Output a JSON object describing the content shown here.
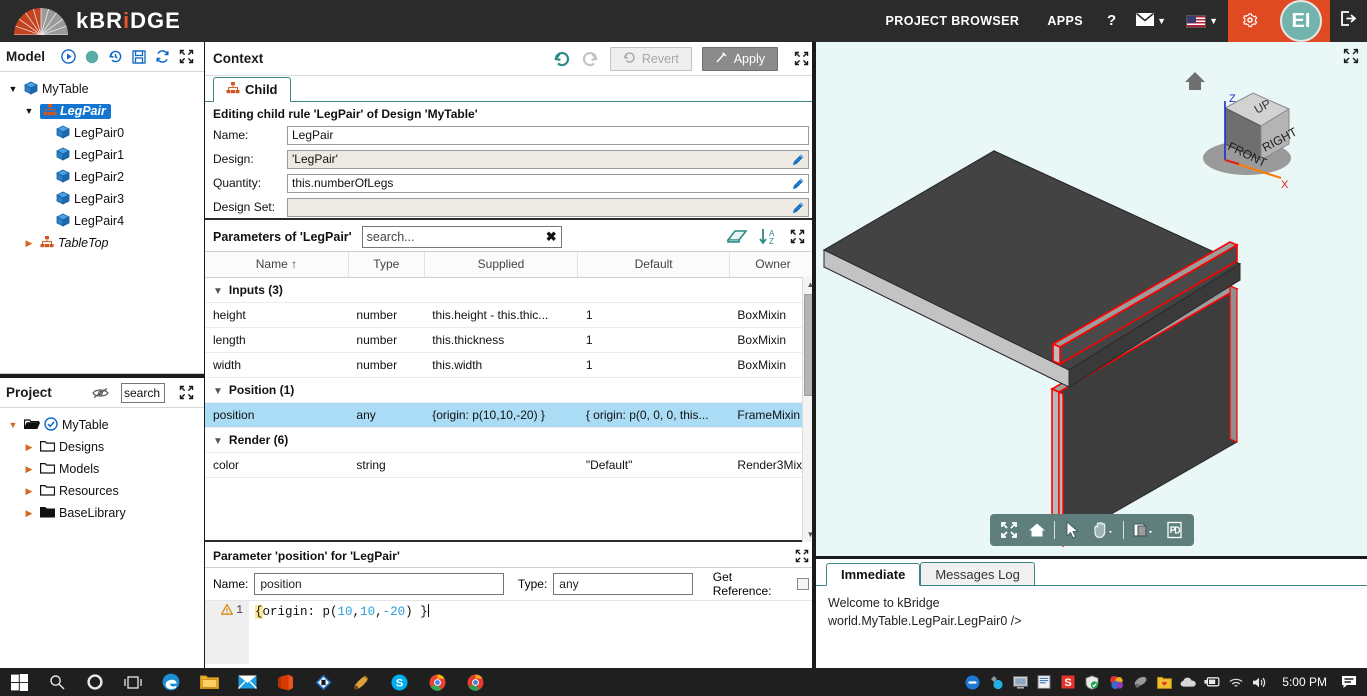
{
  "header": {
    "logo_text_1": "kBR",
    "logo_text_i": "i",
    "logo_text_2": "DGE",
    "project_browser": "PROJECT BROWSER",
    "apps": "APPS",
    "help": "?",
    "mail_icon": "mail-icon",
    "flag_icon": "us-flag-icon",
    "gear_icon": "gear-icon",
    "avatar_initials": "EI",
    "logout_icon": "logout-icon",
    "accent_orange": "#e04a22",
    "avatar_color": "#73b3ad"
  },
  "model_panel": {
    "title": "Model",
    "toolbar": [
      {
        "name": "run-icon",
        "glyph": "▶"
      },
      {
        "name": "status-dot-icon",
        "glyph": "●"
      },
      {
        "name": "history-icon",
        "glyph": "↺"
      },
      {
        "name": "save-icon",
        "glyph": "὚B"
      },
      {
        "name": "refresh-icon",
        "glyph": "↻"
      },
      {
        "name": "expand-icon",
        "glyph": "⤡"
      }
    ],
    "tree": [
      {
        "label": "MyTable",
        "icon": "cube-icon",
        "indent": 0,
        "twisty": "down",
        "selected": false,
        "italic": false
      },
      {
        "label": "LegPair",
        "icon": "tree-icon",
        "indent": 1,
        "twisty": "down",
        "selected": true,
        "italic": true
      },
      {
        "label": "LegPair0",
        "icon": "cube-icon",
        "indent": 2,
        "twisty": "none",
        "selected": false,
        "italic": false
      },
      {
        "label": "LegPair1",
        "icon": "cube-icon",
        "indent": 2,
        "twisty": "none",
        "selected": false,
        "italic": false
      },
      {
        "label": "LegPair2",
        "icon": "cube-icon",
        "indent": 2,
        "twisty": "none",
        "selected": false,
        "italic": false
      },
      {
        "label": "LegPair3",
        "icon": "cube-icon",
        "indent": 2,
        "twisty": "none",
        "selected": false,
        "italic": false
      },
      {
        "label": "LegPair4",
        "icon": "cube-icon",
        "indent": 2,
        "twisty": "none",
        "selected": false,
        "italic": false
      },
      {
        "label": "TableTop",
        "icon": "tree-icon",
        "indent": 1,
        "twisty": "right",
        "selected": false,
        "italic": true
      }
    ]
  },
  "project_panel": {
    "title": "Project",
    "hide_icon": "eye-slash-icon",
    "search_value": "search",
    "expand_icon": "expand-icon",
    "tree": [
      {
        "label": "MyTable",
        "icon": "check-circle-icon",
        "indent": 0,
        "twisty": "down",
        "folder": "open"
      },
      {
        "label": "Designs",
        "icon": "folder-icon",
        "indent": 1,
        "twisty": "right",
        "folder": "outline"
      },
      {
        "label": "Models",
        "icon": "folder-icon",
        "indent": 1,
        "twisty": "right",
        "folder": "outline"
      },
      {
        "label": "Resources",
        "icon": "folder-icon",
        "indent": 1,
        "twisty": "right",
        "folder": "outline"
      },
      {
        "label": "BaseLibrary",
        "icon": "folder-icon",
        "indent": 1,
        "twisty": "right",
        "folder": "filled"
      }
    ]
  },
  "context_panel": {
    "title": "Context",
    "undo_icon": "undo-icon",
    "redo_icon": "redo-icon",
    "revert_label": "Revert",
    "apply_label": "Apply",
    "expand_icon": "expand-icon",
    "tab_label": "Child",
    "subtitle": "Editing child rule 'LegPair' of Design 'MyTable'",
    "fields": [
      {
        "label": "Name:",
        "value": "LegPair",
        "readonly": false,
        "pencil": false
      },
      {
        "label": "Design:",
        "value": "'LegPair'",
        "readonly": true,
        "pencil": true
      },
      {
        "label": "Quantity:",
        "value": "this.numberOfLegs",
        "readonly": false,
        "pencil": true
      },
      {
        "label": "Design Set:",
        "value": "",
        "readonly": true,
        "pencil": true
      }
    ]
  },
  "params_panel": {
    "title": "Parameters of 'LegPair'",
    "search_placeholder": "search...",
    "clear_icon": "clear-icon",
    "eraser_icon": "eraser-icon",
    "sort_icon": "sort-az-icon",
    "expand_icon": "expand-icon",
    "columns": [
      "Name ↑",
      "Type",
      "Supplied",
      "Default",
      "Owner"
    ],
    "rows": [
      {
        "kind": "group",
        "label": "Inputs (3)"
      },
      {
        "kind": "row",
        "selected": false,
        "cells": [
          "height",
          "number",
          "this.height - this.thic...",
          "1",
          "BoxMixin"
        ]
      },
      {
        "kind": "row",
        "selected": false,
        "cells": [
          "length",
          "number",
          "this.thickness",
          "1",
          "BoxMixin"
        ]
      },
      {
        "kind": "row",
        "selected": false,
        "cells": [
          "width",
          "number",
          "this.width",
          "1",
          "BoxMixin"
        ]
      },
      {
        "kind": "group",
        "label": "Position (1)"
      },
      {
        "kind": "row",
        "selected": true,
        "cells": [
          "position",
          "any",
          "{origin: p(10,10,-20) }",
          "{ origin: p(0, 0, 0, this...",
          "FrameMixin"
        ]
      },
      {
        "kind": "group",
        "label": "Render (6)"
      },
      {
        "kind": "row",
        "selected": false,
        "cells": [
          "color",
          "string",
          "",
          "\"Default\"",
          "Render3Mixin"
        ]
      }
    ]
  },
  "param_editor": {
    "title": "Parameter 'position' for 'LegPair'",
    "expand_icon": "expand-icon",
    "name_label": "Name:",
    "name_value": "position",
    "type_label": "Type:",
    "type_value": "any",
    "get_reference_label": "Get Reference:",
    "get_reference_checked": false,
    "line_number": "1",
    "warning_icon": "warning-icon",
    "code_prefix": "{origin: p(",
    "code_n1": "10",
    "code_c1": ",",
    "code_n2": "10",
    "code_c2": ",",
    "code_n3": "-20",
    "code_suffix": ") }"
  },
  "viewport": {
    "expand_icon": "expand-icon",
    "cube_faces": {
      "top": "UP",
      "front": "FRONT",
      "right": "RIGHT"
    },
    "axis_z": "Z",
    "axis_x": "X",
    "home_icon": "home-icon",
    "background_color": "#e9f7f7",
    "model_color": "#3f3f3f",
    "highlight_color": "#ff0000",
    "toolbar": [
      {
        "name": "fit-view-icon",
        "glyph": "✣"
      },
      {
        "name": "home-view-icon",
        "glyph": "⌂"
      },
      {
        "name": "separator",
        "glyph": "|"
      },
      {
        "name": "select-cursor-icon",
        "glyph": "➤"
      },
      {
        "name": "pan-hand-icon",
        "glyph": "✋"
      },
      {
        "name": "separator",
        "glyph": "|"
      },
      {
        "name": "shading-mode-icon",
        "glyph": "❑"
      },
      {
        "name": "export-pdf-icon",
        "glyph": "⎙"
      }
    ]
  },
  "console": {
    "tabs": [
      {
        "label": "Immediate",
        "active": true
      },
      {
        "label": "Messages Log",
        "active": false
      }
    ],
    "lines": [
      "Welcome to kBridge",
      "world.MyTable.LegPair.LegPair0 />"
    ]
  },
  "taskbar": {
    "items": [
      {
        "name": "start-button-icon"
      },
      {
        "name": "search-icon"
      },
      {
        "name": "cortana-icon"
      },
      {
        "name": "task-view-icon"
      },
      {
        "name": "edge-browser-icon"
      },
      {
        "name": "file-explorer-icon"
      },
      {
        "name": "mail-app-icon"
      },
      {
        "name": "office-icon"
      },
      {
        "name": "app-icon"
      },
      {
        "name": "paint-icon"
      },
      {
        "name": "skype-icon"
      },
      {
        "name": "chrome-icon"
      },
      {
        "name": "chrome-canary-icon"
      }
    ],
    "tray": [
      {
        "name": "tray-app-blue-icon"
      },
      {
        "name": "tray-droplet-icon"
      },
      {
        "name": "tray-display-icon"
      },
      {
        "name": "tray-document-icon"
      },
      {
        "name": "tray-snagit-icon"
      },
      {
        "name": "tray-security-icon"
      },
      {
        "name": "tray-colors-icon"
      },
      {
        "name": "tray-satellite-icon"
      },
      {
        "name": "tray-folder-heart-icon"
      },
      {
        "name": "tray-onedrive-icon"
      },
      {
        "name": "tray-battery-icon"
      },
      {
        "name": "tray-wifi-icon"
      },
      {
        "name": "tray-volume-icon"
      }
    ],
    "clock": "5:00 PM",
    "action_center_icon": "action-center-icon"
  }
}
